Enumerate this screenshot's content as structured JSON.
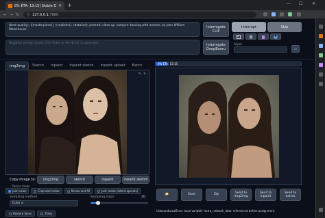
{
  "browser": {
    "tab_title": "8% ETA: 13:15] Stable Diffusion",
    "url_host": "127.0.0.1",
    "url_port": ":7860"
  },
  "prompt": {
    "text": "(best quality), ((masterpiece)), ((realistic)), (detailed), portrait, close up, vampire dancing with women, by John William Waterhouse",
    "negative_placeholder": "Negative prompt (press Ctrl+Enter or Alt+Enter to generate)"
  },
  "buttons": {
    "interrogate_clip": "Interrogate CLIP",
    "interrogate_deepbooru": "Interrogate DeepBooru",
    "interrupt": "Interrupt",
    "skip": "Skip"
  },
  "styles": {
    "label": "Styles"
  },
  "left": {
    "tabs": [
      "img2img",
      "Sketch",
      "Inpaint",
      "Inpaint sketch",
      "Inpaint upload",
      "Batch"
    ],
    "copy_label": "Copy image to:",
    "copy_targets": [
      "img2img",
      "sketch",
      "inpaint",
      "inpaint sketch"
    ],
    "resize_label": "Resize mode",
    "resize_modes": [
      "Just resize",
      "Crop and resize",
      "Resize and fill",
      "Just resize (latent upscale)"
    ],
    "sampler_label": "Sampling method",
    "sampler_value": "Euler a",
    "steps_label": "Sampling steps",
    "steps_value": "20",
    "steps_min": 1,
    "steps_max": 150,
    "checks": [
      "Restore faces",
      "Tiling"
    ]
  },
  "right": {
    "progress_text": "8% ETA: 13:15",
    "progress_fraction": 0.08,
    "actions": [
      "📁",
      "Save",
      "Zip",
      "Send to img2img",
      "Send to inpaint",
      "Send to extras"
    ],
    "warning": "UnboundLocalError: local variable 'extra_network_data' referenced before assignment"
  },
  "colors": {
    "accent": "#2563eb",
    "background": "#0b0f19",
    "panel": "#1f2937"
  }
}
